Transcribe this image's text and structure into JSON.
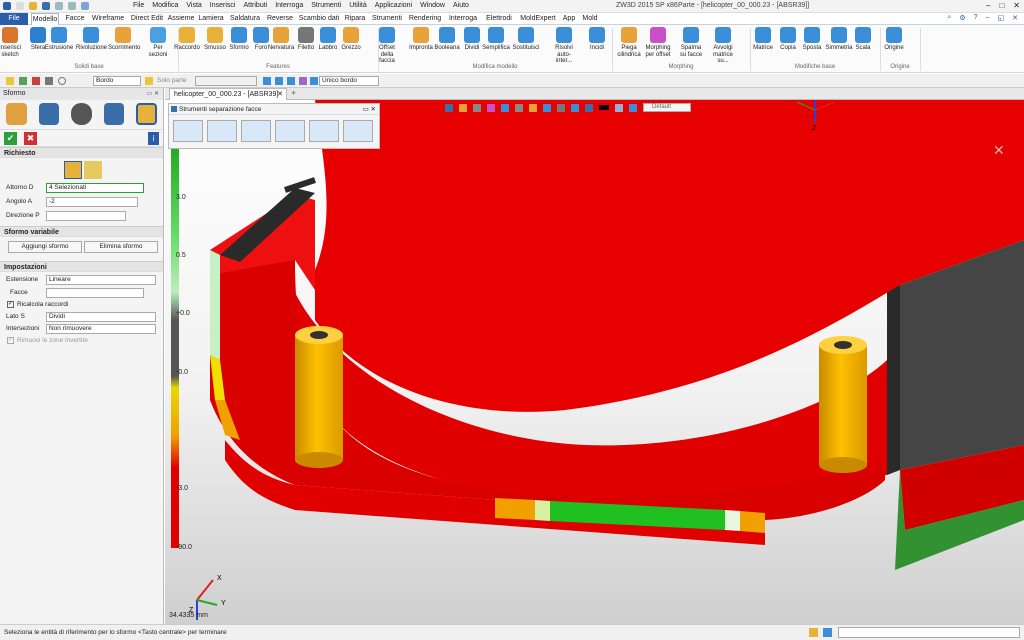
{
  "window": {
    "title": "ZW3D 2015 SP x86",
    "doc": "Parte - [helicopter_00_000.23 - [ABSR39]]"
  },
  "menu": [
    "File",
    "Modifica",
    "Vista",
    "Inserisci",
    "Attributi",
    "Interroga",
    "Strumenti",
    "Utilità",
    "Applicazioni",
    "Window",
    "Aiuto"
  ],
  "tabs": [
    "File",
    "Modello",
    "Facce",
    "Wireframe",
    "Direct Edit",
    "Assieme",
    "Lamiera",
    "Saldatura",
    "Reverse",
    "Scambio dati",
    "Ripara",
    "Strumenti",
    "Rendering",
    "Interroga",
    "Elettrodi",
    "MoldExpert",
    "App",
    "Mold"
  ],
  "ribbon": {
    "items": [
      {
        "l1": "Inserisci",
        "l2": "sketch",
        "color": "#d9762b"
      },
      {
        "l1": "Sfera",
        "l2": "",
        "color": "#2f7fd0"
      },
      {
        "l1": "Estrusione",
        "l2": "",
        "color": "#3a8fd8"
      },
      {
        "l1": "Rivoluzione",
        "l2": "",
        "color": "#3a8fd8"
      },
      {
        "l1": "Scorrimento",
        "l2": "",
        "color": "#e8a23a"
      },
      {
        "l1": "Per",
        "l2": "sezioni",
        "color": "#4aa0e0"
      },
      {
        "l1": "Raccordo",
        "l2": "",
        "color": "#e8b23a"
      },
      {
        "l1": "Smusso",
        "l2": "",
        "color": "#e8b23a"
      },
      {
        "l1": "Sformo",
        "l2": "",
        "color": "#3a8fd8"
      },
      {
        "l1": "Foro",
        "l2": "",
        "color": "#3a8fd8"
      },
      {
        "l1": "Nervatura",
        "l2": "",
        "color": "#e8a23a"
      },
      {
        "l1": "Filetto",
        "l2": "",
        "color": "#777777"
      },
      {
        "l1": "Labbro",
        "l2": "",
        "color": "#3a8fd8"
      },
      {
        "l1": "Grezzo",
        "l2": "",
        "color": "#e8a23a"
      },
      {
        "l1": "Offset della",
        "l2": "faccia",
        "color": "#3a8fd8"
      },
      {
        "l1": "Impronta",
        "l2": "",
        "color": "#e8a23a"
      },
      {
        "l1": "Booleana",
        "l2": "",
        "color": "#3a8fd8"
      },
      {
        "l1": "Dividi",
        "l2": "",
        "color": "#3a8fd8"
      },
      {
        "l1": "Semplifica",
        "l2": "",
        "color": "#3a8fd8"
      },
      {
        "l1": "Sostituisci",
        "l2": "",
        "color": "#3a8fd8"
      },
      {
        "l1": "Risolvi",
        "l2": "auto-inter...",
        "color": "#3a8fd8"
      },
      {
        "l1": "Incidi",
        "l2": "",
        "color": "#3a8fd8"
      },
      {
        "l1": "Piega",
        "l2": "cilindrica",
        "color": "#e8a23a"
      },
      {
        "l1": "Morphing",
        "l2": "per offset",
        "color": "#c850c8"
      },
      {
        "l1": "Spalma",
        "l2": "su facce",
        "color": "#3a8fd8"
      },
      {
        "l1": "Avvolgi",
        "l2": "matrice su...",
        "color": "#3a8fd8"
      },
      {
        "l1": "Matrice",
        "l2": "",
        "color": "#3a8fd8"
      },
      {
        "l1": "Copia",
        "l2": "",
        "color": "#3a8fd8"
      },
      {
        "l1": "Sposta",
        "l2": "",
        "color": "#3a8fd8"
      },
      {
        "l1": "Simmetria",
        "l2": "",
        "color": "#3a8fd8"
      },
      {
        "l1": "Scala",
        "l2": "",
        "color": "#3a8fd8"
      },
      {
        "l1": "Origine",
        "l2": "",
        "color": "#3a8fd8"
      }
    ],
    "groups": [
      "Solidi base",
      "Features",
      "Modifica modello",
      "Morphing",
      "Modifiche base",
      "Origine"
    ]
  },
  "toolbar": {
    "filter": "Bordo",
    "solo": "Solo parte",
    "edge": "Unico bordo"
  },
  "panel": {
    "title": "Sformo",
    "section1": "Richiesto",
    "attorno_label": "Attorno D",
    "attorno_value": "4 Selezionati",
    "angolo_label": "Angolo A",
    "angolo_value": "-2",
    "direzione_label": "Direzione P",
    "direzione_value": "",
    "section2": "Sformo variabile",
    "add_btn": "Aggiungi sformo",
    "del_btn": "Elimina sformo",
    "section3": "Impostazioni",
    "estensione_label": "Estensione",
    "estensione_value": "Lineare",
    "facce_label": "Facce",
    "facce_value": "",
    "ricalcola": "Ricalcola raccordi",
    "lato_label": "Lato S",
    "lato_value": "Dividi",
    "inters_label": "Intersezioni",
    "inters_value": "Non rimuovere",
    "rimuovi": "Rimuovi le zone invertite"
  },
  "doc_tab": "helicopter_00_000.23 - [ABSR39]",
  "floating": {
    "title": "Strumenti separazione facce"
  },
  "view_combo": "Default",
  "scale": [
    "3.0",
    "0.5",
    "+0.0",
    "-0.0",
    "-3.0",
    "-90.0"
  ],
  "scale_colors": [
    "#22aa22",
    "#66dd66",
    "#bbeebb",
    "#555555",
    "#e8d800",
    "#f0a000",
    "#e00000"
  ],
  "axis": {
    "z": "Z",
    "x": "X",
    "y": "Y"
  },
  "dimension": "34.4335 mm",
  "status": "Seleziona le entità di riferimento per lo sformo  <Tasto centrale> per terminare"
}
